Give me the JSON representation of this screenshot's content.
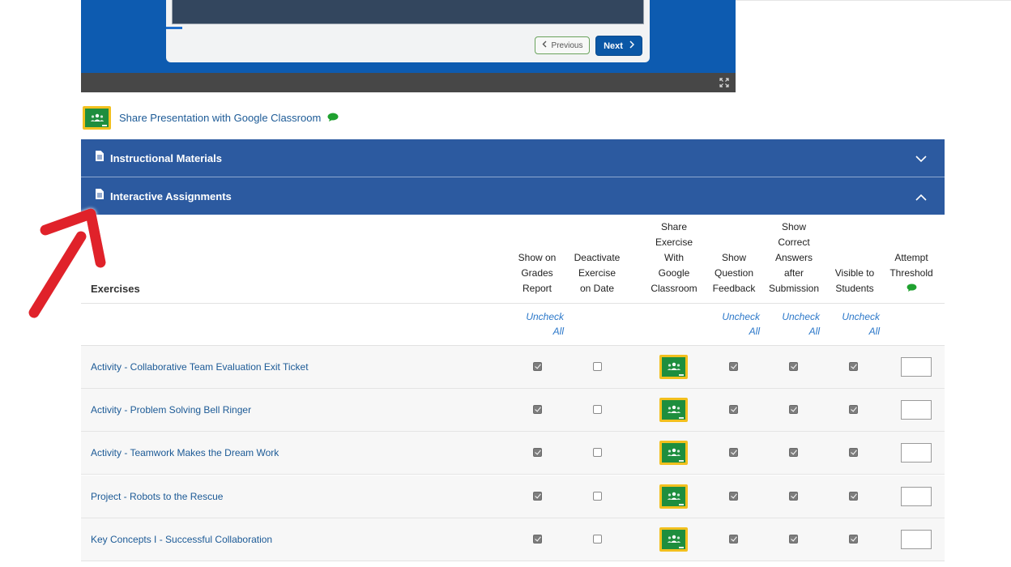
{
  "viewer": {
    "prev_label": "Previous",
    "next_label": "Next",
    "fullscreen_icon": "fullscreen-icon"
  },
  "share": {
    "label": "Share Presentation with Google Classroom",
    "icon": "google-classroom-icon",
    "comment_icon": "comment-icon",
    "comment_color": "#1fa12f"
  },
  "accordion": {
    "instructional": {
      "title": "Instructional Materials",
      "state": "collapsed"
    },
    "interactive": {
      "title": "Interactive Assignments",
      "state": "expanded"
    },
    "color": "#2c5aa0"
  },
  "table": {
    "exercises_header": "Exercises",
    "columns": [
      {
        "key": "grades",
        "lines": [
          "Show on",
          "Grades",
          "Report"
        ]
      },
      {
        "key": "deactivate",
        "lines": [
          "Deactivate",
          "Exercise",
          "on Date"
        ]
      },
      {
        "key": "share",
        "lines": [
          "Share",
          "Exercise",
          "With",
          "Google",
          "Classroom"
        ]
      },
      {
        "key": "feedback",
        "lines": [
          "Show",
          "Question",
          "Feedback"
        ]
      },
      {
        "key": "correct",
        "lines": [
          "Show",
          "Correct",
          "Answers",
          "after",
          "Submission"
        ]
      },
      {
        "key": "visible",
        "lines": [
          "Visible to",
          "Students"
        ]
      },
      {
        "key": "threshold",
        "lines": [
          "Attempt",
          "Threshold"
        ]
      }
    ],
    "uncheck_all": {
      "line1": "Uncheck",
      "line2": "All"
    },
    "rows": [
      {
        "name": "Activity - Collaborative Team Evaluation Exit Ticket",
        "grades": true,
        "deactivate": false,
        "feedback": true,
        "correct": true,
        "visible": true,
        "threshold": ""
      },
      {
        "name": "Activity - Problem Solving Bell Ringer",
        "grades": true,
        "deactivate": false,
        "feedback": true,
        "correct": true,
        "visible": true,
        "threshold": ""
      },
      {
        "name": "Activity - Teamwork Makes the Dream Work",
        "grades": true,
        "deactivate": false,
        "feedback": true,
        "correct": true,
        "visible": true,
        "threshold": ""
      },
      {
        "name": "Project - Robots to the Rescue",
        "grades": true,
        "deactivate": false,
        "feedback": true,
        "correct": true,
        "visible": true,
        "threshold": ""
      },
      {
        "name": "Key Concepts I - Successful Collaboration",
        "grades": true,
        "deactivate": false,
        "feedback": true,
        "correct": true,
        "visible": true,
        "threshold": ""
      }
    ]
  },
  "annotation": {
    "icon": "red-arrow-icon",
    "color": "#e0202a"
  }
}
